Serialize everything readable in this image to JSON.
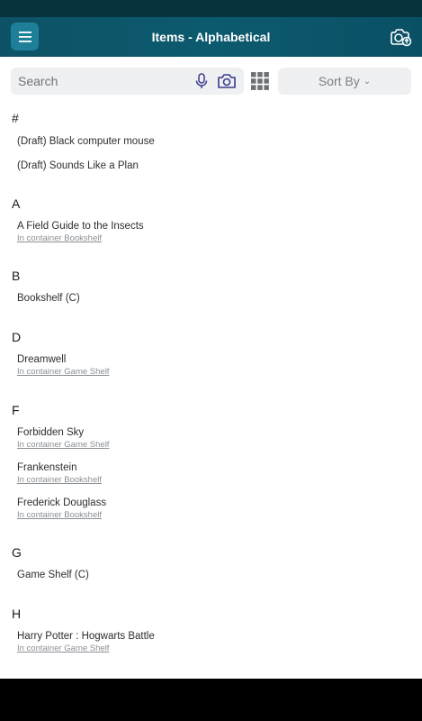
{
  "header": {
    "title": "Items - Alphabetical"
  },
  "search": {
    "placeholder": "Search"
  },
  "sort": {
    "label": "Sort By"
  },
  "sections": [
    {
      "letter": "#",
      "items": [
        {
          "title": "(Draft) Black computer mouse",
          "sub": ""
        },
        {
          "title": "(Draft) Sounds Like a Plan",
          "sub": ""
        }
      ]
    },
    {
      "letter": "A",
      "items": [
        {
          "title": "A Field Guide to the Insects",
          "sub": "In container Bookshelf"
        }
      ]
    },
    {
      "letter": "B",
      "items": [
        {
          "title": "Bookshelf (C)",
          "sub": ""
        }
      ]
    },
    {
      "letter": "D",
      "items": [
        {
          "title": "Dreamwell",
          "sub": "In container Game Shelf"
        }
      ]
    },
    {
      "letter": "F",
      "items": [
        {
          "title": "Forbidden Sky",
          "sub": "In container Game Shelf"
        },
        {
          "title": "Frankenstein",
          "sub": "In container Bookshelf"
        },
        {
          "title": "Frederick Douglass",
          "sub": "In container Bookshelf"
        }
      ]
    },
    {
      "letter": "G",
      "items": [
        {
          "title": "Game Shelf (C)",
          "sub": ""
        }
      ]
    },
    {
      "letter": "H",
      "items": [
        {
          "title": "Harry Potter : Hogwarts Battle",
          "sub": "In container Game Shelf"
        }
      ]
    }
  ],
  "icons": {
    "menu": "menu-icon",
    "camera_upload": "camera-upload-icon",
    "mic": "microphone-icon",
    "camera": "camera-icon",
    "grid": "grid-view-icon",
    "sort_chevron": "chevron-down-icon"
  },
  "colors": {
    "appbar": "#0c5a6e",
    "menu_button": "#1e7f99",
    "accent_icon": "#3a3a8c"
  }
}
